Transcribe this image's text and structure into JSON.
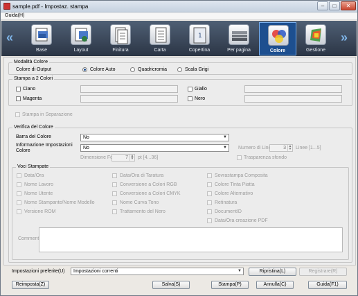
{
  "window": {
    "title": "sample.pdf - Impostaz. stampa",
    "buttons": [
      "–",
      "□",
      "✕"
    ]
  },
  "menu": {
    "help": "Guida(H)"
  },
  "toolbar": {
    "left_arrow": "«",
    "right_arrow": "»",
    "tabs": [
      {
        "label": "Base",
        "icon": "base-icon"
      },
      {
        "label": "Layout",
        "icon": "layout-icon"
      },
      {
        "label": "Finitura",
        "icon": "finishing-icon"
      },
      {
        "label": "Carta",
        "icon": "paper-icon"
      },
      {
        "label": "Copertina",
        "icon": "cover-icon"
      },
      {
        "label": "Per pagina",
        "icon": "per-page-icon"
      },
      {
        "label": "Colore",
        "icon": "color-icon",
        "active": true
      },
      {
        "label": "Gestione",
        "icon": "management-icon"
      }
    ]
  },
  "color_mode": {
    "title": "Modalità Colore",
    "output_label": "Colore di Output",
    "options": [
      "Colore Auto",
      "Quadricromia",
      "Scala Grigi"
    ],
    "selected": "Colore Auto"
  },
  "two_color": {
    "title": "Stampa a 2 Colori",
    "items": [
      "Ciano",
      "Magenta",
      "Giallo",
      "Nero"
    ]
  },
  "separation": {
    "label": "Stampa in Separazione"
  },
  "color_check": {
    "title": "Verifica del Colore",
    "color_bar_label": "Barra del Colore",
    "color_bar_value": "No",
    "settings_info_label": "Informazione Impostazioni Colore",
    "settings_info_value": "No",
    "line_count_label": "Numero di Linee",
    "line_count_value": "3",
    "line_count_range": "Linee [1...5]",
    "font_size_label": "Dimensione Font",
    "font_size_value": "7",
    "font_size_range": "pt [4...36]",
    "transparent_bg_label": "Trasparenza sfondo"
  },
  "printed_items": {
    "title": "Voci Stampate",
    "col1": [
      "Data/Ora",
      "Nome Lavoro",
      "Nome Utente",
      "Nome Stampante/Nome Modello",
      "Versione ROM"
    ],
    "col2": [
      "Data/Ora di Taratura",
      "Conversione a Colori RGB",
      "Conversione a Colori CMYK",
      "Nome Curva Tono",
      "Trattamento del Nero"
    ],
    "col3": [
      "Sovrastampa Composita",
      "Colore Tinta Piatta",
      "Colore Alternativo",
      "Retinatura",
      "DocumentID",
      "Data/Ora creazione PDF"
    ],
    "comment_label": "Commento"
  },
  "footer": {
    "favorites_label": "Impostazioni preferite(U)",
    "favorites_value": "Impostazioni correnti",
    "restore": "Ripristina(L)",
    "register": "Registrare(R)",
    "reset": "Reimposta(Z)",
    "save": "Salva(S)",
    "print": "Stampa(P)",
    "cancel": "Annulla(C)",
    "help": "Guida(F1)"
  }
}
